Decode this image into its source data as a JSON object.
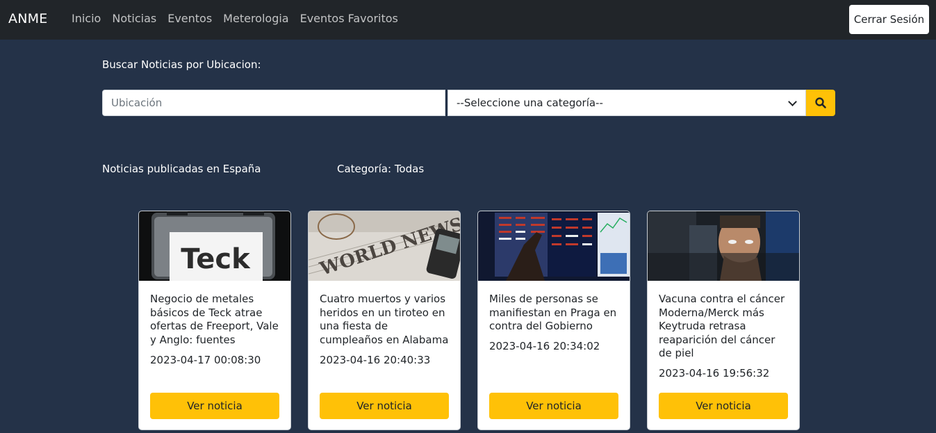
{
  "navbar": {
    "brand": "ANME",
    "links": [
      "Inicio",
      "Noticias",
      "Eventos",
      "Meterologia",
      "Eventos Favoritos"
    ],
    "logout_label": "Cerrar Sesión"
  },
  "search": {
    "title": "Buscar Noticias por Ubicacion:",
    "location_placeholder": "Ubicación",
    "category_selected": "--Seleccione una categoría--",
    "search_icon": "search-icon"
  },
  "filters": {
    "location_text": "Noticias publicadas en España",
    "category_text": "Categoría: Todas"
  },
  "news": [
    {
      "title": "Negocio de metales básicos de Teck atrae ofertas de Freeport, Vale y Anglo: fuentes",
      "date": "2023-04-17 00:08:30",
      "button": "Ver noticia",
      "image_text": "Teck"
    },
    {
      "title": "Cuatro muertos y varios heridos en un tiroteo en una fiesta de cumpleaños en Alabama",
      "date": "2023-04-16 20:40:33",
      "button": "Ver noticia",
      "image_text": "WORLD NEWS"
    },
    {
      "title": "Miles de personas se manifiestan en Praga en contra del Gobierno",
      "date": "2023-04-16 20:34:02",
      "button": "Ver noticia"
    },
    {
      "title": "Vacuna contra el cáncer Moderna/Merck más Keytruda retrasa reaparición del cáncer de piel",
      "date": "2023-04-16 19:56:32",
      "button": "Ver noticia"
    }
  ],
  "colors": {
    "background": "#243248",
    "navbar": "#212529",
    "accent": "#ffc107"
  }
}
